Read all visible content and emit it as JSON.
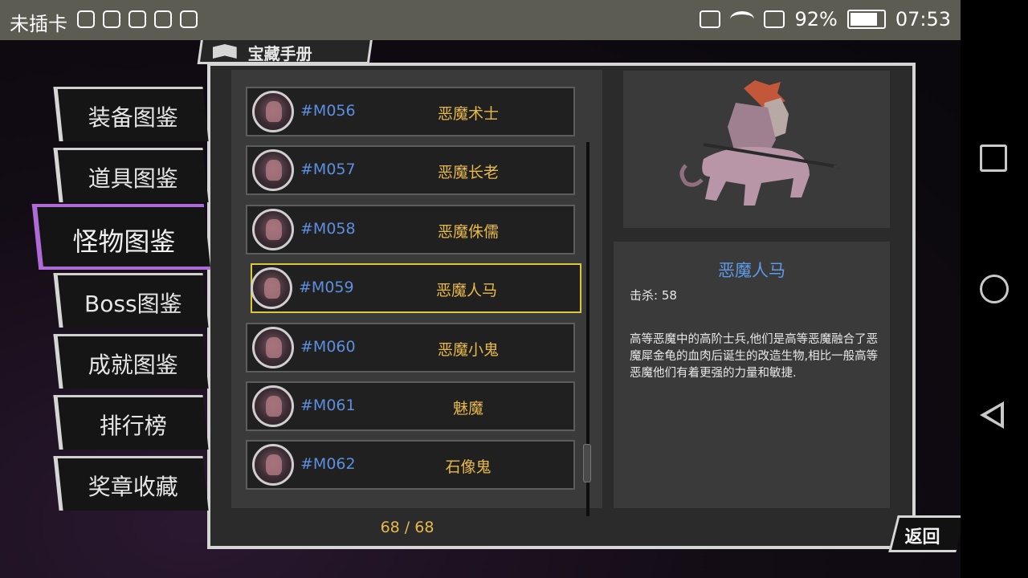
{
  "status_bar": {
    "carrier": "未插卡",
    "battery_percent": "92%",
    "time": "07:53"
  },
  "panel_title": "宝藏手册",
  "sidebar": {
    "tabs": [
      {
        "label": "装备图鉴",
        "active": false
      },
      {
        "label": "道具图鉴",
        "active": false
      },
      {
        "label": "怪物图鉴",
        "active": true
      },
      {
        "label": "Boss图鉴",
        "active": false
      },
      {
        "label": "成就图鉴",
        "active": false
      },
      {
        "label": "排行榜",
        "active": false
      },
      {
        "label": "奖章收藏",
        "active": false
      }
    ]
  },
  "monster_list": {
    "items": [
      {
        "code": "#M056",
        "name": "恶魔术士",
        "selected": false
      },
      {
        "code": "#M057",
        "name": "恶魔长老",
        "selected": false
      },
      {
        "code": "#M058",
        "name": "恶魔侏儒",
        "selected": false
      },
      {
        "code": "#M059",
        "name": "恶魔人马",
        "selected": true
      },
      {
        "code": "#M060",
        "name": "恶魔小鬼",
        "selected": false
      },
      {
        "code": "#M061",
        "name": "魅魔",
        "selected": false
      },
      {
        "code": "#M062",
        "name": "石像鬼",
        "selected": false
      }
    ],
    "page_count": "68 / 68"
  },
  "detail": {
    "name": "恶魔人马",
    "kills": "击杀: 58",
    "description": "高等恶魔中的高阶士兵,他们是高等恶魔融合了恶魔犀金龟的血肉后诞生的改造生物,相比一般高等恶魔他们有着更强的力量和敏捷."
  },
  "back_button": "返回",
  "colors": {
    "accent_purple": "#b06ad8",
    "code_blue": "#5d8fe0",
    "name_gold": "#e7b94b",
    "selection_yellow": "#d9c93a"
  }
}
